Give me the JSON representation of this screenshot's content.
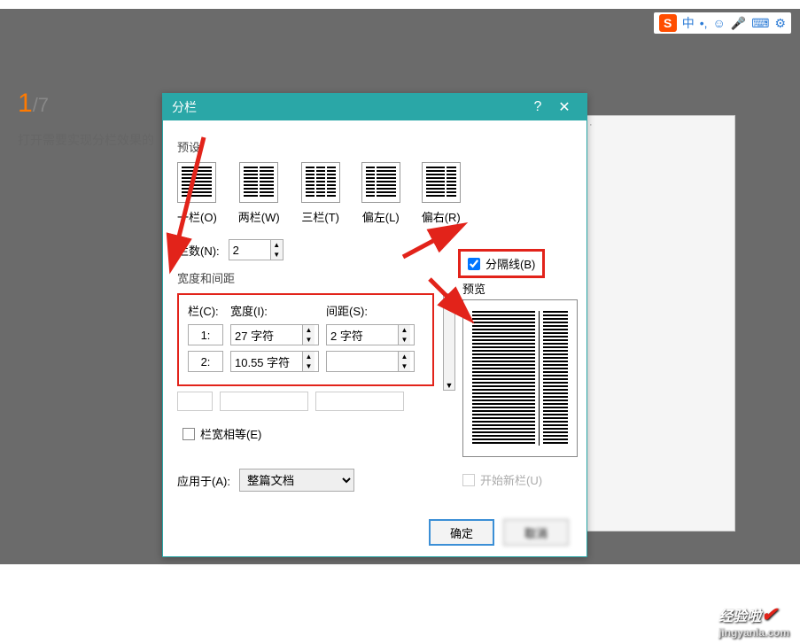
{
  "ime": {
    "logo": "S",
    "items": [
      "中",
      "•,",
      "☺",
      "🎤",
      "⌨",
      "⚙"
    ]
  },
  "page": {
    "current": "1",
    "total": "/7",
    "caption": "打开需要实现分栏效果的"
  },
  "dialog": {
    "title": "分栏",
    "help": "?",
    "close": "✕",
    "preset_label": "预设",
    "presets": {
      "one": "一栏(O)",
      "two": "两栏(W)",
      "three": "三栏(T)",
      "left": "偏左(L)",
      "right": "偏右(R)"
    },
    "cols_label": "栏数(N):",
    "cols_value": "2",
    "separator_label": "分隔线(B)",
    "width_label": "宽度和间距",
    "preview_label": "预览",
    "headers": {
      "col": "栏(C):",
      "width": "宽度(I):",
      "gap": "间距(S):"
    },
    "row1": {
      "idx": "1:",
      "width": "27 字符",
      "gap": "2 字符"
    },
    "row2": {
      "idx": "2:",
      "width": "10.55 字符",
      "gap": ""
    },
    "equal_label": "栏宽相等(E)",
    "apply_label": "应用于(A):",
    "apply_value": "整篇文档",
    "newcol_label": "开始新栏(U)",
    "ok": "确定",
    "cancel": "取消"
  },
  "watermark": {
    "brand": "经验啦",
    "url": "jingyanla.com"
  }
}
